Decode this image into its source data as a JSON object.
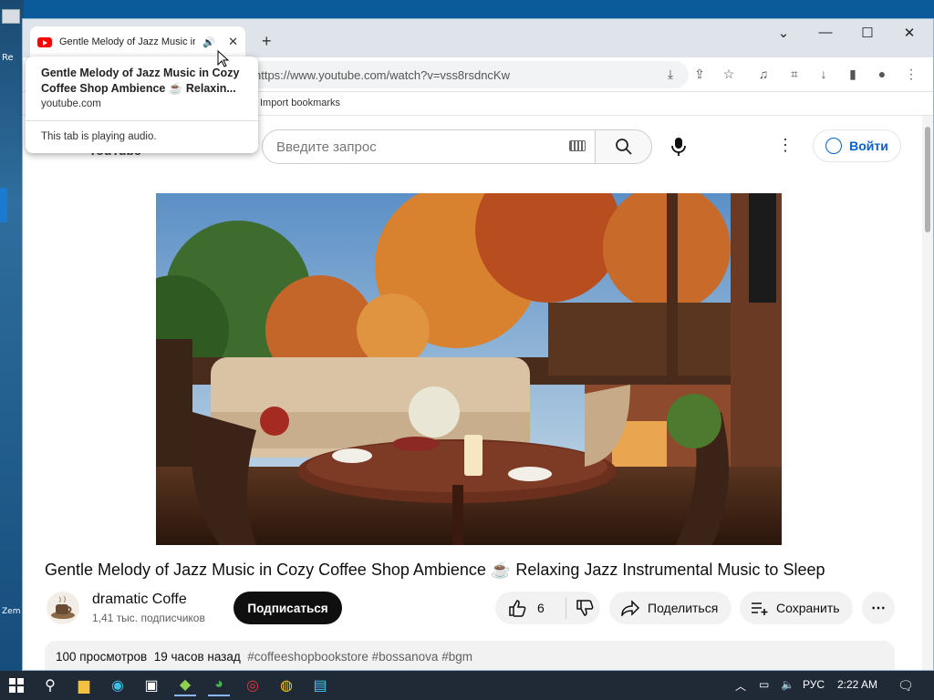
{
  "desktop": {
    "labels": [
      "Re",
      "Zem"
    ]
  },
  "browser": {
    "tab_title": "Gentle Melody of Jazz Music in",
    "url": "https://www.youtube.com/watch?v=vss8rsdncKw",
    "bookmark": "Import bookmarks",
    "popup": {
      "title": "Gentle Melody of Jazz Music in Cozy Coffee Shop Ambience ☕ Relaxin...",
      "domain": "youtube.com",
      "status": "This tab is playing audio."
    }
  },
  "youtube": {
    "logo": "YouTube",
    "search_placeholder": "Введите запрос",
    "signin": "Войти",
    "video_title": "Gentle Melody of Jazz Music in Cozy Coffee Shop Ambience ☕ Relaxing Jazz Instrumental Music to Sleep",
    "channel_name": "dramatic Coffe",
    "subscribers": "1,41 тыс. подписчиков",
    "subscribe": "Подписаться",
    "likes": "6",
    "share": "Поделиться",
    "save": "Сохранить",
    "views": "100 просмотров",
    "age": "19 часов назад",
    "tags": "#coffeeshopbookstore #bossanova #bgm"
  },
  "taskbar": {
    "language": "РУС",
    "time": "2:22 AM"
  },
  "colors": {
    "youtube_red": "#ff0000",
    "link_blue": "#065fd4",
    "taskbar": "#1f2a36"
  }
}
